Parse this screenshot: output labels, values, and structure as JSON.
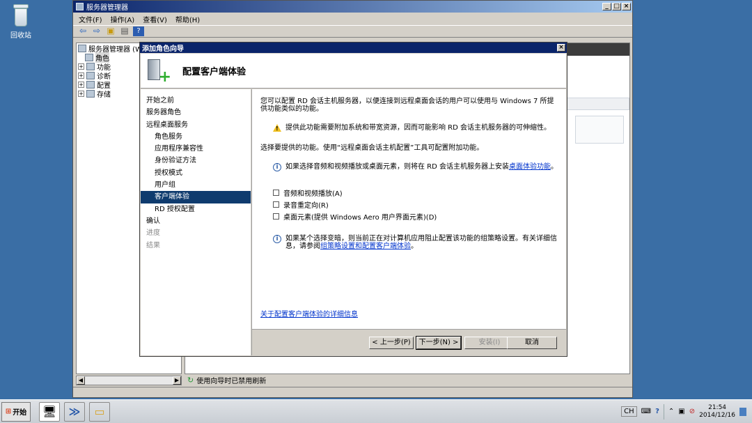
{
  "desktop": {
    "recycle_bin_label": "回收站"
  },
  "server_manager": {
    "title": "服务器管理器",
    "menu": [
      "文件(F)",
      "操作(A)",
      "查看(V)",
      "帮助(H)"
    ],
    "tree": {
      "root": "服务器管理器 (W",
      "items": [
        "角色",
        "功能",
        "诊断",
        "配置",
        "存储"
      ]
    },
    "status_text": "使用向导时已禁用刷新"
  },
  "wizard": {
    "title": "添加角色向导",
    "header_title": "配置客户端体验",
    "nav": [
      {
        "label": "开始之前",
        "state": "normal",
        "level": 0
      },
      {
        "label": "服务器角色",
        "state": "normal",
        "level": 0
      },
      {
        "label": "远程桌面服务",
        "state": "normal",
        "level": 0
      },
      {
        "label": "角色服务",
        "state": "normal",
        "level": 1
      },
      {
        "label": "应用程序兼容性",
        "state": "normal",
        "level": 1
      },
      {
        "label": "身份验证方法",
        "state": "normal",
        "level": 1
      },
      {
        "label": "授权模式",
        "state": "normal",
        "level": 1
      },
      {
        "label": "用户组",
        "state": "normal",
        "level": 1
      },
      {
        "label": "客户端体验",
        "state": "selected",
        "level": 1
      },
      {
        "label": "RD 授权配置",
        "state": "normal",
        "level": 1
      },
      {
        "label": "确认",
        "state": "normal",
        "level": 0
      },
      {
        "label": "进度",
        "state": "disabled",
        "level": 0
      },
      {
        "label": "结果",
        "state": "disabled",
        "level": 0
      }
    ],
    "intro_text": "您可以配置 RD 会话主机服务器，以便连接到远程桌面会话的用户可以使用与 Windows 7 所提供功能类似的功能。",
    "warning_text": "提供此功能需要附加系统和带宽资源，因而可能影响 RD 会话主机服务器的可伸缩性。",
    "select_text": "选择要提供的功能。使用“远程桌面会话主机配置”工具可配置附加功能。",
    "info1_text": "如果选择音频和视频播放或桌面元素，则将在 RD 会话主机服务器上安装",
    "info1_link": "桌面体验功能",
    "info1_end": "。",
    "checkboxes": [
      "音频和视频播放(A)",
      "录音重定向(R)",
      "桌面元素(提供 Windows Aero 用户界面元素)(D)"
    ],
    "info2_text": "如果某个选择变暗，则当前正在对计算机应用阻止配置该功能的组策略设置。有关详细信息，请参阅",
    "info2_link": "组策略设置和配置客户端体验",
    "info2_end": "。",
    "more_info_link": "关于配置客户端体验的详细信息",
    "buttons": {
      "back": "< 上一步(P)",
      "next": "下一步(N) >",
      "install": "安装(I)",
      "cancel": "取消"
    }
  },
  "taskbar": {
    "start_label": "开始",
    "language": "CH",
    "time": "21:54",
    "date": "2014/12/16"
  }
}
